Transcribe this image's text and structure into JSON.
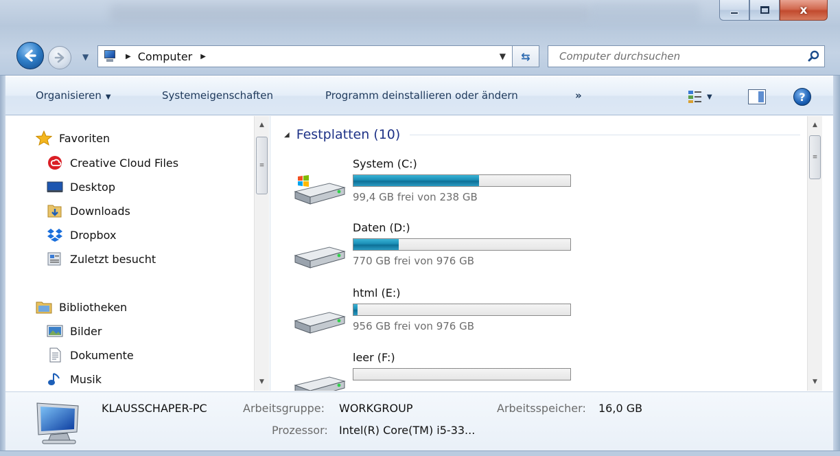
{
  "window": {
    "minimize_symbol": "",
    "close_symbol": "x"
  },
  "addressbar": {
    "crumbs": [
      "Computer"
    ],
    "search_placeholder": "Computer durchsuchen"
  },
  "toolbar": {
    "organize": "Organisieren",
    "system_properties": "Systemeigenschaften",
    "uninstall": "Programm deinstallieren oder ändern",
    "more": "»"
  },
  "navigation": {
    "favorites_header": "Favoriten",
    "favorites": [
      {
        "label": "Creative Cloud Files",
        "icon": "creative-cloud-icon"
      },
      {
        "label": "Desktop",
        "icon": "desktop-icon"
      },
      {
        "label": "Downloads",
        "icon": "downloads-folder-icon"
      },
      {
        "label": "Dropbox",
        "icon": "dropbox-icon"
      },
      {
        "label": "Zuletzt besucht",
        "icon": "recent-places-icon"
      }
    ],
    "libraries_header": "Bibliotheken",
    "libraries": [
      {
        "label": "Bilder",
        "icon": "pictures-library-icon"
      },
      {
        "label": "Dokumente",
        "icon": "documents-library-icon"
      },
      {
        "label": "Musik",
        "icon": "music-library-icon"
      }
    ]
  },
  "content": {
    "group_title": "Festplatten (10)",
    "drives": [
      {
        "name": "System (C:)",
        "free_text": "99,4 GB frei von 238 GB",
        "used_fraction": 0.58,
        "system": true
      },
      {
        "name": "Daten (D:)",
        "free_text": "770 GB frei von 976 GB",
        "used_fraction": 0.21,
        "system": false
      },
      {
        "name": "html (E:)",
        "free_text": "956 GB frei von 976 GB",
        "used_fraction": 0.02,
        "system": false
      },
      {
        "name": "leer (F:)",
        "free_text": "",
        "used_fraction": 0.0,
        "system": false
      }
    ]
  },
  "details": {
    "computer_name": "KLAUSSCHAPER-PC",
    "workgroup_label": "Arbeitsgruppe:",
    "workgroup_value": "WORKGROUP",
    "memory_label": "Arbeitsspeicher:",
    "memory_value": "16,0 GB",
    "processor_label": "Prozessor:",
    "processor_value": "Intel(R) Core(TM) i5-33..."
  },
  "colors": {
    "accent_blue": "#1e3287",
    "bar_fill": "#1a8db5",
    "muted_text": "#6d6d6d"
  }
}
